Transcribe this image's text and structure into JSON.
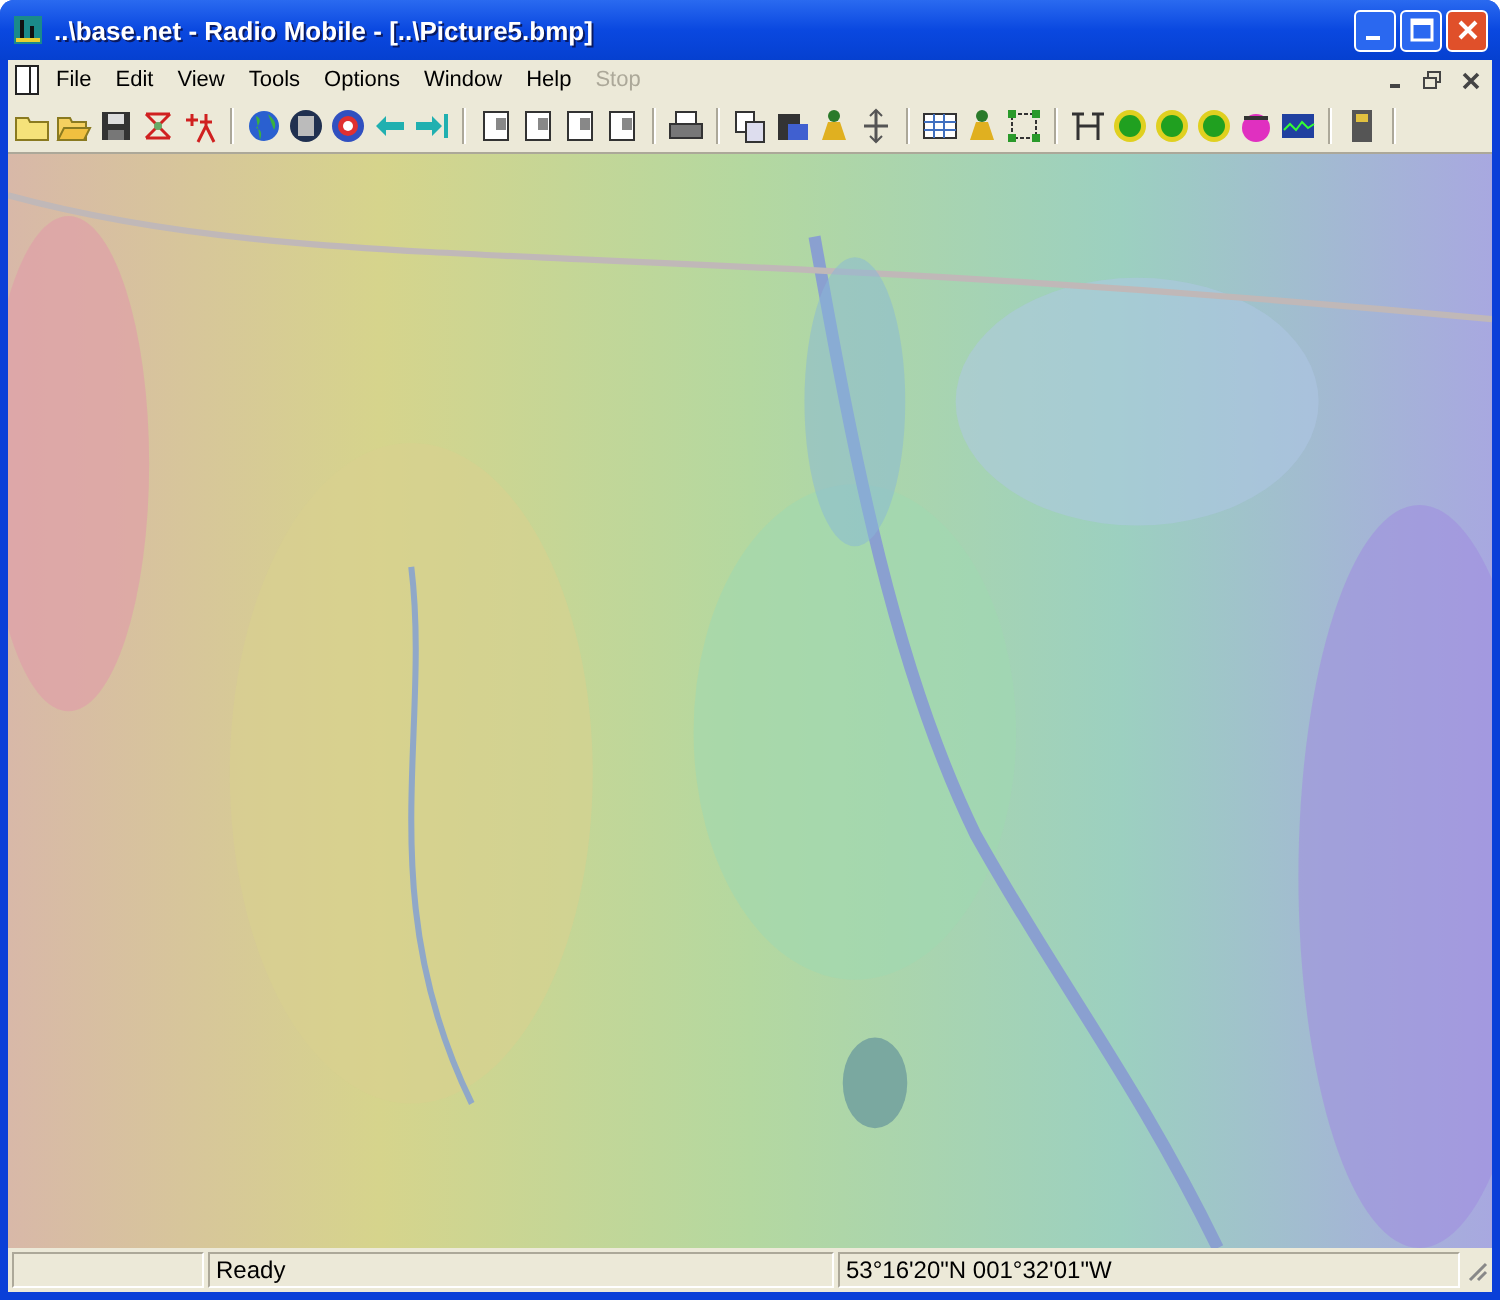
{
  "window": {
    "title": "..\\base.net - Radio Mobile - [..\\Picture5.bmp]"
  },
  "menu": [
    {
      "label": "File",
      "disabled": false
    },
    {
      "label": "Edit",
      "disabled": false
    },
    {
      "label": "View",
      "disabled": false
    },
    {
      "label": "Tools",
      "disabled": false
    },
    {
      "label": "Options",
      "disabled": false
    },
    {
      "label": "Window",
      "disabled": false
    },
    {
      "label": "Help",
      "disabled": false
    },
    {
      "label": "Stop",
      "disabled": true
    }
  ],
  "status_bar": {
    "message": "Ready",
    "coordinates": "53°16'20\"N 001°32'01\"W"
  }
}
